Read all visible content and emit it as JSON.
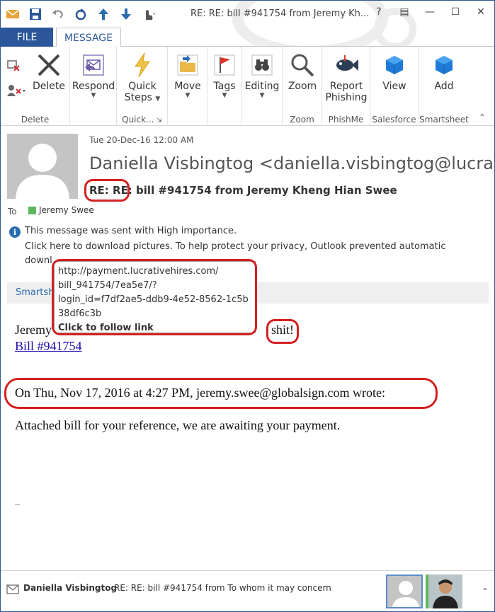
{
  "window": {
    "title": "RE: RE: bill #941754 from Jeremy Kh...",
    "help": "?",
    "controls": [
      "restore-icon",
      "minimize-icon",
      "maximize-icon",
      "close-icon"
    ]
  },
  "tabs": {
    "file": "FILE",
    "message": "MESSAGE"
  },
  "ribbon": {
    "delete_group": {
      "label": "Delete",
      "delete_btn": "Delete"
    },
    "respond": "Respond",
    "quick_steps": {
      "line1": "Quick",
      "line2": "Steps",
      "group": "Quick..."
    },
    "move": "Move",
    "tags": "Tags",
    "editing": "Editing",
    "zoom": {
      "btn": "Zoom",
      "group": "Zoom"
    },
    "phishme": {
      "line1": "Report",
      "line2": "Phishing",
      "group": "PhishMe"
    },
    "salesforce": {
      "btn": "View",
      "group": "Salesforce"
    },
    "smartsheet": {
      "btn": "Add",
      "group": "Smartsheet"
    }
  },
  "message": {
    "date": "Tue 20-Dec-16 12:00 AM",
    "sender": "Daniella Visbingtog <daniella.visbingtog@lucrati",
    "subject_prefix": "RE: RE:",
    "subject_rest": " bill #941754 from Jeremy Kheng Hian Swee",
    "to_label": "To",
    "to_name": "Jeremy Swee",
    "info_importance": "This message was sent with High importance.",
    "info_pictures_1": "Click here to download pictures. To help protect your privacy, Outlook prevented automatic",
    "info_pictures_2": "downl",
    "smartsheet_bar": "Smartsh",
    "body_line1_start": "Jeremy",
    "body_line1_end": "shit!",
    "body_link": "Bill #941754",
    "quote_header": "On Thu, Nov 17, 2016 at 4:27 PM, jeremy.swee@globalsign.com wrote:",
    "quote_body": "Attached bill for your reference, we are awaiting your payment.",
    "sig_mark": "--"
  },
  "tooltip": {
    "lines": [
      "http://payment.lucrativehires.com/",
      "bill_941754/7ea5e7/?",
      "login_id=f7df2ae5-ddb9-4e52-8562-1c5b",
      "38df6c3b"
    ],
    "follow": "Click to follow link"
  },
  "people_bar": {
    "name": "Daniella Visbingtog",
    "subject": "RE: RE: bill #941754 from To whom it may concern"
  },
  "colors": {
    "accent": "#2b579a",
    "annotation": "#d32020"
  }
}
